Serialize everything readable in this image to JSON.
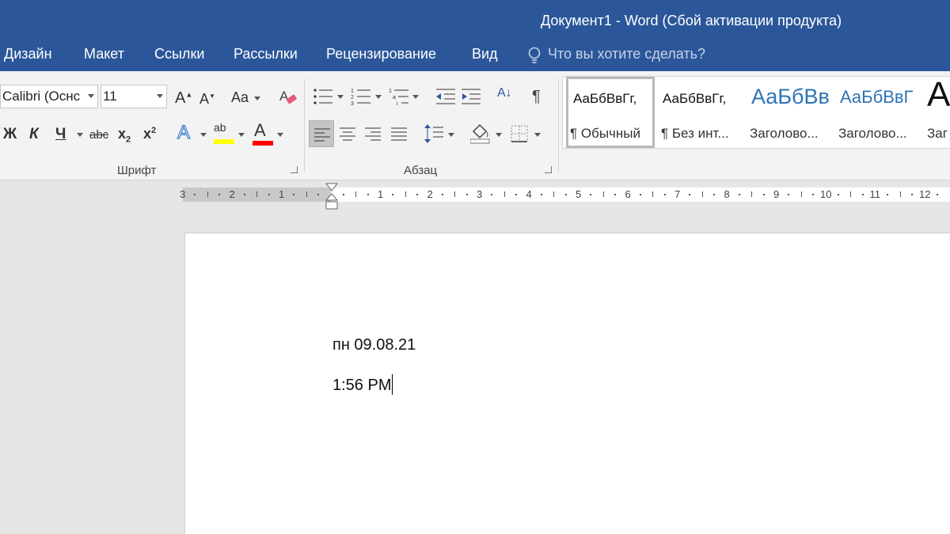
{
  "window": {
    "title": "Документ1 - Word (Сбой активации продукта)"
  },
  "tabs": [
    "Дизайн",
    "Макет",
    "Ссылки",
    "Рассылки",
    "Рецензирование",
    "Вид"
  ],
  "tell_me": {
    "placeholder": "Что вы хотите сделать?",
    "icon": "lightbulb-icon"
  },
  "font_group": {
    "label": "Шрифт",
    "font_name": "Calibri (Оснс",
    "font_size": "11",
    "grow_label": "A",
    "shrink_label": "A",
    "case_label": "Aa",
    "bold": "Ж",
    "italic": "К",
    "underline": "Ч",
    "strike": "abc",
    "subscript": "x",
    "subscript_mark": "2",
    "superscript": "x",
    "superscript_mark": "2",
    "text_effects": "A",
    "highlight": "ab",
    "font_color": "A",
    "highlight_color": "#ffff00",
    "font_color_value": "#ff0000"
  },
  "paragraph_group": {
    "label": "Абзац",
    "sort_label": "А↓",
    "pilcrow": "¶"
  },
  "styles": [
    {
      "preview": "АаБбВвГг,",
      "name": "¶ Обычный",
      "selected": true
    },
    {
      "preview": "АаБбВвГг,",
      "name": "¶ Без инт...",
      "selected": false
    },
    {
      "preview": "АаБбВв",
      "name": "Заголово...",
      "selected": false
    },
    {
      "preview": "АаБбВвГ",
      "name": "Заголово...",
      "selected": false
    },
    {
      "preview": "А",
      "name": "Заг",
      "selected": false
    }
  ],
  "ruler": {
    "left_numbers": [
      "3",
      "2",
      "1"
    ],
    "right_numbers": [
      "1",
      "2",
      "3",
      "4",
      "5",
      "6",
      "7",
      "8",
      "9",
      "10",
      "11",
      "12"
    ]
  },
  "document": {
    "lines": [
      "пн 09.08.21",
      "1:56 PM"
    ]
  },
  "colors": {
    "accent": "#2b579a",
    "ribbon": "#f3f3f3"
  }
}
